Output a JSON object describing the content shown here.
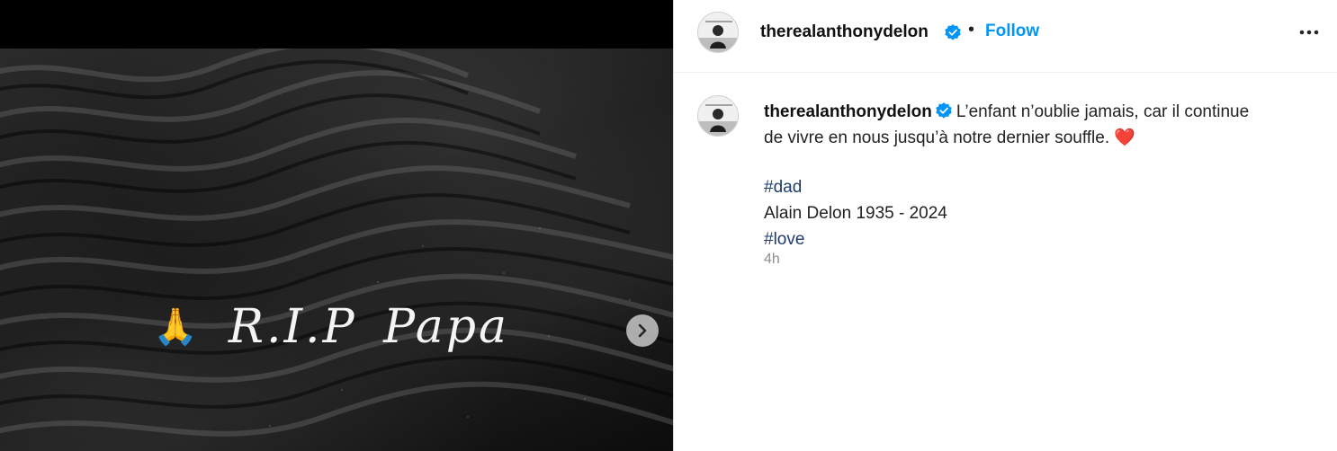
{
  "post": {
    "overlay_emoji": "🙏",
    "overlay_text": "R.I.P  Papa"
  },
  "header": {
    "username": "therealanthonydelon",
    "separator": "•",
    "follow_label": "Follow"
  },
  "caption": {
    "username": "therealanthonydelon",
    "text_line1": "L’enfant n’oublie jamais, car il continue",
    "text_line2": "de vivre en nous jusqu’à notre dernier souffle.",
    "heart": "❤️",
    "hashtag1": "#dad",
    "line_dates": "Alain Delon 1935 - 2024",
    "hashtag2": "#love",
    "timestamp": "4h"
  },
  "icons": {
    "verified": "verified-badge-icon",
    "more": "more-options-icon",
    "next": "chevron-right-icon"
  },
  "colors": {
    "accent": "#0095f6",
    "verified": "#0095f6",
    "hashtag": "#1f3c6b"
  }
}
